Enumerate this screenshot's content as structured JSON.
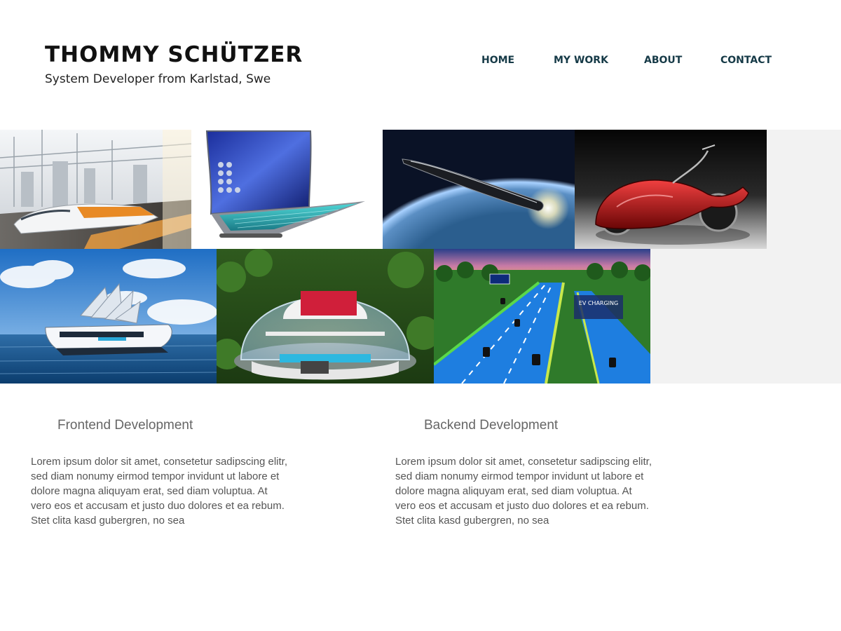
{
  "header": {
    "title": "THOMMY SCHÜTZER",
    "subtitle": "System Developer from Karlstad, Swe"
  },
  "nav": {
    "items": [
      {
        "label": "HOME"
      },
      {
        "label": "MY WORK"
      },
      {
        "label": "ABOUT"
      },
      {
        "label": "CONTACT"
      }
    ]
  },
  "gallery": {
    "images": [
      {
        "icon": "high-speed-train-image"
      },
      {
        "icon": "flexible-laptop-image"
      },
      {
        "icon": "rocket-over-earth-image"
      },
      {
        "icon": "red-motorcycle-image"
      },
      {
        "icon": "solar-boat-image"
      },
      {
        "icon": "dome-house-image"
      },
      {
        "icon": "ev-charging-highway-image"
      }
    ],
    "highway_signs": [
      "EV CHARGING"
    ]
  },
  "sections": [
    {
      "title": "Frontend Development",
      "lines": [
        "Lorem ipsum dolor sit amet, consetetur sadipscing elitr,",
        "sed diam nonumy eirmod tempor invidunt ut labore et",
        "dolore magna aliquyam erat, sed diam voluptua. At",
        "vero eos et accusam et justo duo dolores et ea rebum.",
        "Stet clita kasd gubergren, no sea"
      ]
    },
    {
      "title": "Backend Development",
      "lines": [
        "Lorem ipsum dolor sit amet, consetetur sadipscing elitr,",
        "sed diam nonumy eirmod tempor invidunt ut labore et",
        "dolore magna aliquyam erat, sed diam voluptua. At",
        "vero eos et accusam et justo duo dolores et ea rebum.",
        "Stet clita kasd gubergren, no sea"
      ]
    }
  ],
  "colors": {
    "nav_text": "#163a47",
    "title_text": "#111111",
    "body_text": "#555555",
    "gallery_background": "#f2f2f2"
  }
}
